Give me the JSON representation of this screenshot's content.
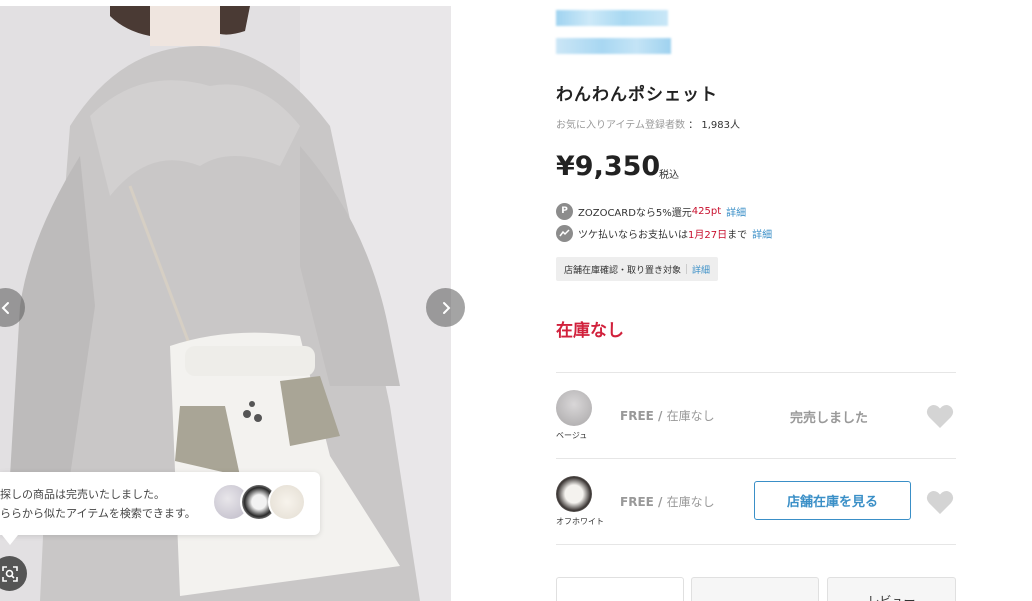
{
  "similar": {
    "line1": "探しの商品は完売いたしました。",
    "line2": "ららから似たアイテムを検索できます。"
  },
  "product": {
    "title": "わんわんポシェット",
    "favorites_label": "お気に入りアイテム登録者数",
    "favorites_sep": "：",
    "favorites_count": "1,983人",
    "price": "¥9,350",
    "tax_label": "税込",
    "points": {
      "icon_label": "P",
      "text_prefix": "ZOZOCARDなら5%還元",
      "amount": "425pt",
      "link": "詳細"
    },
    "tsuke": {
      "text_prefix": "ツケ払いならお支払いは",
      "date": "1月27日",
      "text_suffix": "まで",
      "link": "詳細"
    },
    "store_tag": {
      "label": "店舗在庫確認・取り置き対象",
      "link": "詳細"
    },
    "stock_status": "在庫なし"
  },
  "skus": [
    {
      "color": "ベージュ",
      "size": "FREE",
      "slash": "/",
      "stock": "在庫なし",
      "action": "完売しました"
    },
    {
      "color": "オフホワイト",
      "size": "FREE",
      "slash": "/",
      "stock": "在庫なし",
      "action": "店舗在庫を見る"
    }
  ],
  "bottom_tabs": [
    "",
    "",
    "レビュー"
  ],
  "colors": {
    "accent_blue": "#3a8fc7",
    "price_red": "#c8102e",
    "stock_red": "#d1213c"
  }
}
